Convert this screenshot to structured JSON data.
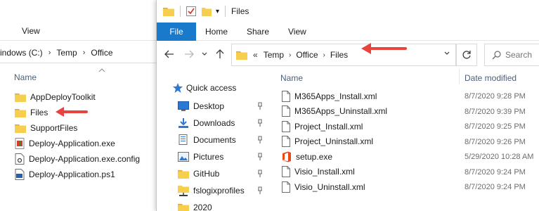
{
  "back_window": {
    "ribbon": {
      "view_label": "View"
    },
    "breadcrumb": {
      "drive": "indows (C:)",
      "temp": "Temp",
      "office": "Office"
    },
    "column": {
      "name": "Name"
    },
    "items": [
      {
        "label": "AppDeployToolkit",
        "icon": "folder-icon"
      },
      {
        "label": "Files",
        "icon": "folder-icon"
      },
      {
        "label": "SupportFiles",
        "icon": "folder-icon"
      },
      {
        "label": "Deploy-Application.exe",
        "icon": "exe-app-icon"
      },
      {
        "label": "Deploy-Application.exe.config",
        "icon": "config-file-icon"
      },
      {
        "label": "Deploy-Application.ps1",
        "icon": "powershell-script-icon"
      }
    ]
  },
  "front_window": {
    "title": "Files",
    "ribbon": {
      "file": "File",
      "home": "Home",
      "share": "Share",
      "view": "View"
    },
    "address": {
      "overflow": "«",
      "crumbs": [
        "Temp",
        "Office",
        "Files"
      ]
    },
    "search": {
      "placeholder": "Search"
    },
    "nav": {
      "quick_access": "Quick access",
      "items": [
        {
          "label": "Desktop",
          "icon": "desktop-icon",
          "pinned": true
        },
        {
          "label": "Downloads",
          "icon": "downloads-icon",
          "pinned": true
        },
        {
          "label": "Documents",
          "icon": "documents-icon",
          "pinned": true
        },
        {
          "label": "Pictures",
          "icon": "pictures-icon",
          "pinned": true
        },
        {
          "label": "GitHub",
          "icon": "folder-icon",
          "pinned": true
        },
        {
          "label": "fslogixprofiles",
          "icon": "network-folder-icon",
          "pinned": true
        },
        {
          "label": "2020",
          "icon": "folder-icon",
          "pinned": false
        }
      ]
    },
    "columns": {
      "name": "Name",
      "date": "Date modified"
    },
    "files": [
      {
        "name": "M365Apps_Install.xml",
        "date": "8/7/2020 9:28 PM",
        "icon": "document-icon"
      },
      {
        "name": "M365Apps_Uninstall.xml",
        "date": "8/7/2020 9:39 PM",
        "icon": "document-icon"
      },
      {
        "name": "Project_Install.xml",
        "date": "8/7/2020 9:25 PM",
        "icon": "document-icon"
      },
      {
        "name": "Project_Uninstall.xml",
        "date": "8/7/2020 9:26 PM",
        "icon": "document-icon"
      },
      {
        "name": "setup.exe",
        "date": "5/29/2020 10:28 AM",
        "icon": "office-setup-icon"
      },
      {
        "name": "Visio_Install.xml",
        "date": "8/7/2020 9:24 PM",
        "icon": "document-icon"
      },
      {
        "name": "Visio_Uninstall.xml",
        "date": "8/7/2020 9:24 PM",
        "icon": "document-icon"
      }
    ]
  },
  "colors": {
    "accent": "#1979ca",
    "arrow": "#e8433f",
    "folder": "#f7cf4f",
    "header_text": "#4c607a"
  }
}
